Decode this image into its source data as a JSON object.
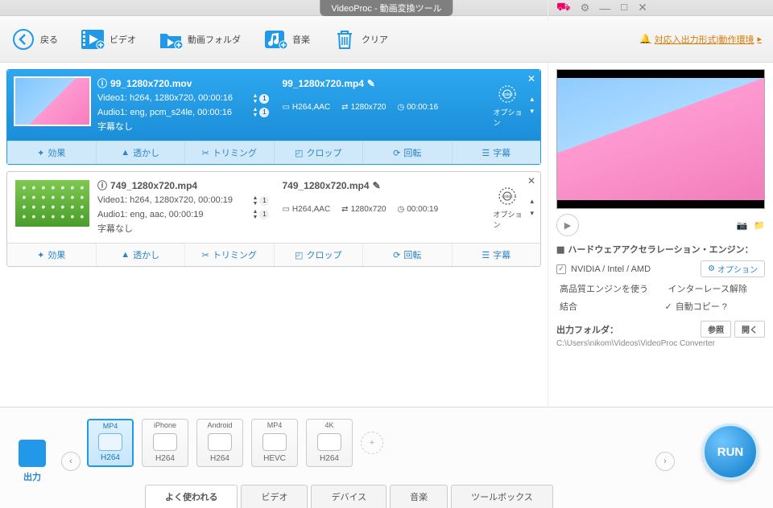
{
  "title": "VideoProc - 動画変換ツール",
  "toolbar": {
    "back": "戻る",
    "video": "ビデオ",
    "folder": "動画フォルダ",
    "music": "音楽",
    "clear": "クリア",
    "link": "対応入出力形式|動作環境"
  },
  "items": [
    {
      "active": true,
      "src_name": "99_1280x720.mov",
      "video_line": "Video1: h264, 1280x720, 00:00:16",
      "audio_line": "Audio1: eng, pcm_s24le, 00:00:16",
      "sub_line": "字幕なし",
      "dst_name": "99_1280x720.mp4",
      "codec": "H264,AAC",
      "res": "1280x720",
      "dur": "00:00:16",
      "opt": "オプション"
    },
    {
      "active": false,
      "src_name": "749_1280x720.mp4",
      "video_line": "Video1: h264, 1280x720, 00:00:19",
      "audio_line": "Audio1: eng, aac, 00:00:19",
      "sub_line": "字幕なし",
      "dst_name": "749_1280x720.mp4",
      "codec": "H264,AAC",
      "res": "1280x720",
      "dur": "00:00:19",
      "opt": "オプション"
    }
  ],
  "strip": {
    "effect": "効果",
    "watermark": "透かし",
    "trim": "トリミング",
    "crop": "クロップ",
    "rotate": "回転",
    "subtitle": "字幕"
  },
  "right": {
    "hw_title": "ハードウェアアクセラレーション・エンジン：",
    "hw_vendor": "NVIDIA / Intel / AMD",
    "hw_opt": "オプション",
    "hq": "高品質エンジンを使う",
    "deint": "インターレース解除",
    "merge": "結合",
    "autocopy": "自動コピー ?",
    "out_label": "出力フォルダ：",
    "out_path": "C:\\Users\\nikom\\Videos\\VideoProc Converter",
    "browse": "参照",
    "open": "開く"
  },
  "presets": [
    {
      "top": "MP4",
      "bot": "H264",
      "sel": true
    },
    {
      "top": "iPhone",
      "bot": "H264",
      "sel": false
    },
    {
      "top": "Android",
      "bot": "H264",
      "sel": false
    },
    {
      "top": "MP4",
      "bot": "HEVC",
      "sel": false
    },
    {
      "top": "4K",
      "bot": "H264",
      "sel": false
    }
  ],
  "output_label": "出力",
  "tabs": {
    "popular": "よく使われる",
    "video": "ビデオ",
    "device": "デバイス",
    "music": "音楽",
    "toolbox": "ツールボックス"
  },
  "run": "RUN"
}
